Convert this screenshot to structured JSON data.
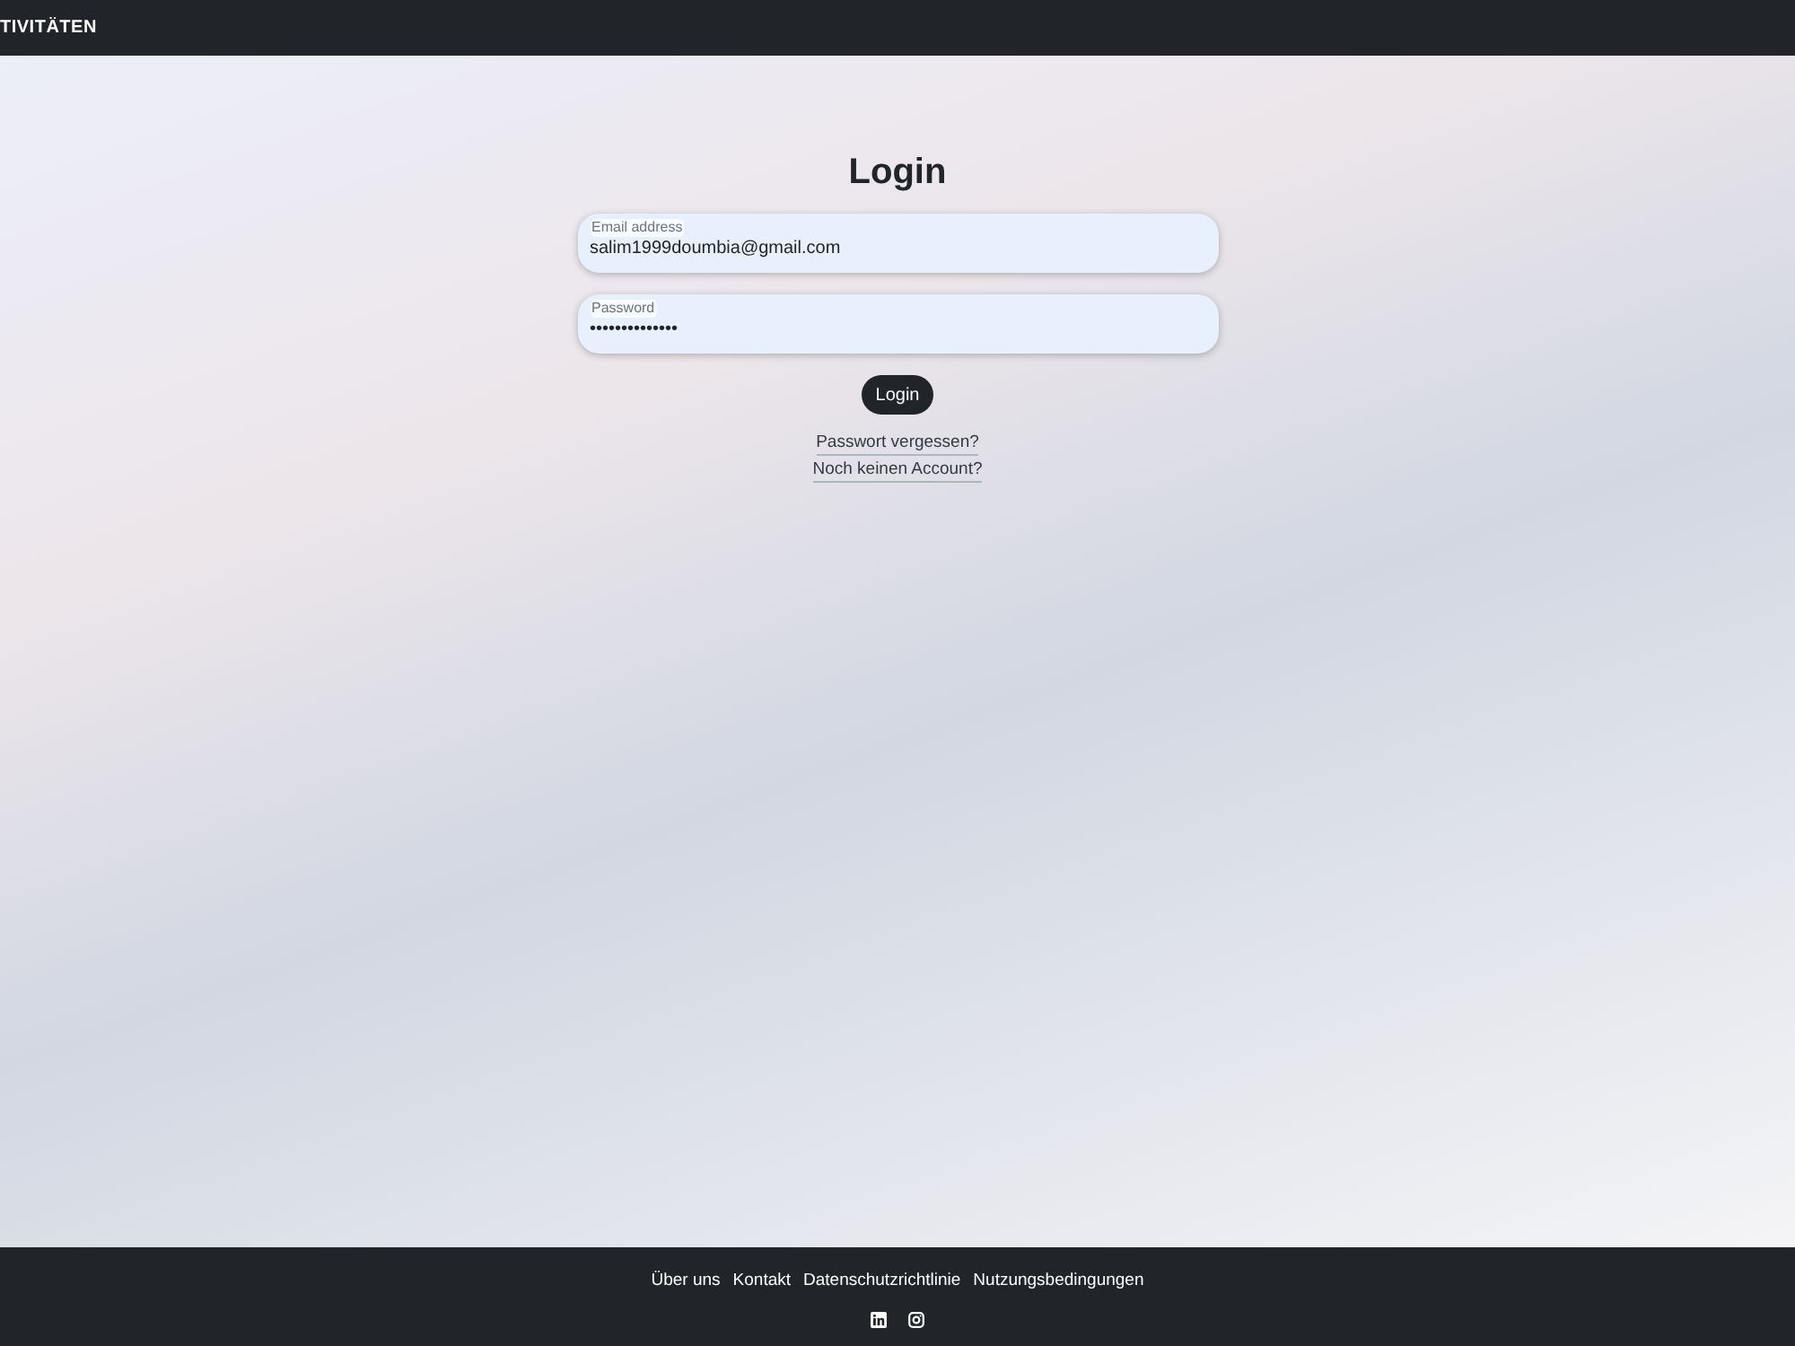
{
  "navbar": {
    "brand": "TIVITÄTEN"
  },
  "login": {
    "title": "Login",
    "fields": [
      {
        "label": "Email address",
        "value": "salim1999doumbia@gmail.com"
      },
      {
        "label": "Password",
        "value": "••••••••••••••"
      }
    ],
    "button": "Login",
    "links": [
      "Passwort vergessen?",
      "Noch keinen Account?"
    ]
  },
  "footer": {
    "links": [
      "Über uns",
      "Kontakt",
      "Datenschutzrichtlinie",
      "Nutzungsbedingungen"
    ]
  }
}
